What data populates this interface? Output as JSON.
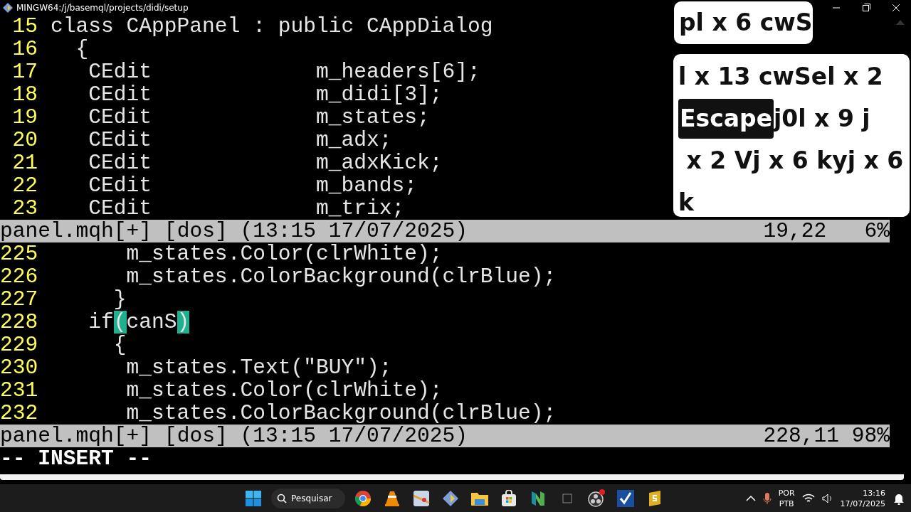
{
  "window": {
    "title": "MINGW64:/j/basemql/projects/didi/setup"
  },
  "panes": [
    {
      "lines": [
        {
          "number": "15",
          "text": "class CAppPanel : public CAppDialog"
        },
        {
          "number": "16",
          "text": "  {"
        },
        {
          "number": "17",
          "text": "   CEdit             m_headers[6];"
        },
        {
          "number": "18",
          "text": "   CEdit             m_didi[3];"
        },
        {
          "number": "19",
          "text": "   CEdit             m_states;"
        },
        {
          "number": "20",
          "text": "   CEdit             m_adx;"
        },
        {
          "number": "21",
          "text": "   CEdit             m_adxKick;"
        },
        {
          "number": "22",
          "text": "   CEdit             m_bands;"
        },
        {
          "number": "23",
          "text": "   CEdit             m_trix;"
        }
      ],
      "status": {
        "file": "panel.mqh[+] [dos] (13:15 17/07/2025)",
        "position": "19,22   6%"
      }
    },
    {
      "lines": [
        {
          "number": "225",
          "text": "      m_states.Color(clrWhite);"
        },
        {
          "number": "226",
          "text": "      m_states.ColorBackground(clrBlue);"
        },
        {
          "number": "227",
          "text": "     }"
        },
        {
          "number": "228",
          "segments": [
            {
              "text": "   if",
              "highlighted": false
            },
            {
              "text": "(",
              "highlighted": true
            },
            {
              "text": "canS",
              "highlighted": false
            },
            {
              "text": ")",
              "highlighted": true
            }
          ]
        },
        {
          "number": "229",
          "text": "     {"
        },
        {
          "number": "230",
          "text": "      m_states.Text(\"BUY\");"
        },
        {
          "number": "231",
          "text": "      m_states.Color(clrWhite);"
        },
        {
          "number": "232",
          "text": "      m_states.ColorBackground(clrBlue);"
        }
      ],
      "status": {
        "file": "panel.mqh[+] [dos] (13:15 17/07/2025)",
        "position": "228,11 98%"
      }
    }
  ],
  "mode": "-- INSERT --",
  "keystrokes": {
    "previous": "pl x 6 cwS",
    "lines": [
      [
        {
          "kind": "text",
          "text": "l x 13 cwSel x 2"
        }
      ],
      [
        {
          "kind": "key",
          "text": "Escape"
        },
        {
          "kind": "text",
          "text": "j0l x 9 j"
        }
      ],
      [
        {
          "kind": "text",
          "text": " x 2 Vj x 6 kyj x 6"
        }
      ],
      [
        {
          "kind": "text",
          "text": "k"
        }
      ]
    ]
  },
  "taskbar": {
    "search": "Pesquisar",
    "language": [
      "POR",
      "PTB"
    ],
    "time": "13:16",
    "date": "17/07/2025"
  }
}
